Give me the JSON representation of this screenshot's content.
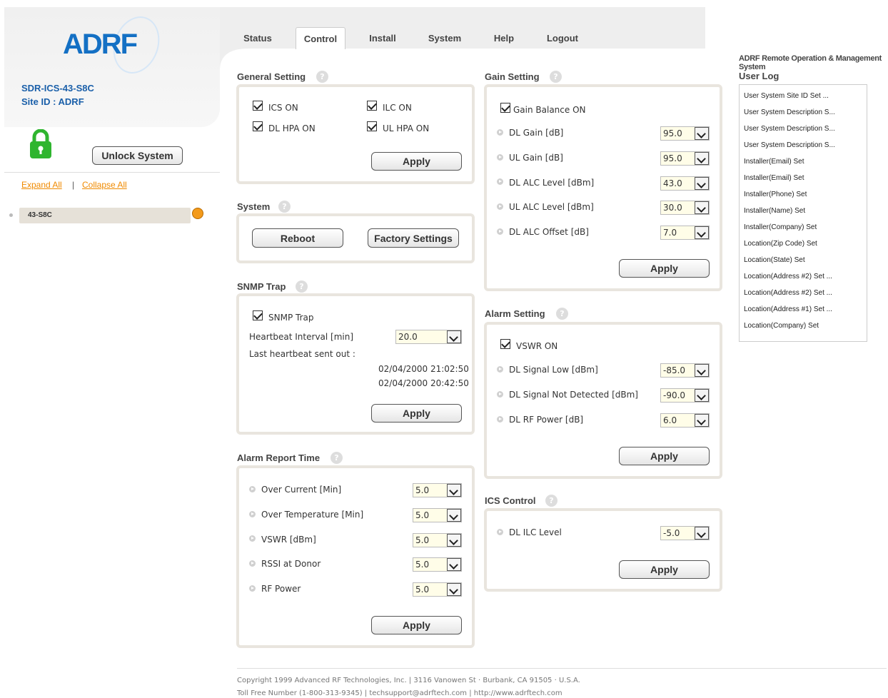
{
  "brand": {
    "logo_text": "ADRF",
    "device_name": "SDR-ICS-43-S8C",
    "site_id": "Site ID : ADRF"
  },
  "sidebar": {
    "unlock_label": "Unlock System",
    "expand_all": "Expand All",
    "separator": "|",
    "collapse_all": "Collapse All",
    "tree_item": "43-S8C",
    "status_color": "#f39a1b"
  },
  "nav": {
    "tabs": [
      "Status",
      "Control",
      "Install",
      "System",
      "Help",
      "Logout"
    ],
    "active": "Control"
  },
  "general_setting": {
    "title": "General Setting",
    "ics_on": "ICS ON",
    "ilc_on": "ILC ON",
    "dl_hpa_on": "DL HPA ON",
    "ul_hpa_on": "UL HPA ON",
    "apply": "Apply"
  },
  "system": {
    "title": "System",
    "reboot": "Reboot",
    "factory": "Factory Settings"
  },
  "snmp": {
    "title": "SNMP Trap",
    "check_label": "SNMP Trap",
    "heartbeat_label": "Heartbeat Interval [min]",
    "heartbeat_value": "20.0",
    "last_label": "Last heartbeat sent out :",
    "last_1": "02/04/2000 21:02:50",
    "last_2": "02/04/2000 20:42:50",
    "apply": "Apply"
  },
  "alarm_report": {
    "title": "Alarm Report Time",
    "rows": [
      {
        "label": "Over Current [Min]",
        "value": "5.0"
      },
      {
        "label": "Over Temperature [Min]",
        "value": "5.0"
      },
      {
        "label": "VSWR [dBm]",
        "value": "5.0"
      },
      {
        "label": "RSSI at Donor",
        "value": "5.0"
      },
      {
        "label": "RF Power",
        "value": "5.0"
      }
    ],
    "apply": "Apply"
  },
  "gain_setting": {
    "title": "Gain Setting",
    "balance": "Gain Balance ON",
    "rows": [
      {
        "label": "DL Gain [dB]",
        "value": "95.0"
      },
      {
        "label": "UL Gain [dB]",
        "value": "95.0"
      },
      {
        "label": "DL ALC Level [dBm]",
        "value": "43.0"
      },
      {
        "label": "UL ALC Level [dBm]",
        "value": "30.0"
      },
      {
        "label": "DL ALC Offset [dB]",
        "value": "7.0"
      }
    ],
    "apply": "Apply"
  },
  "alarm_setting": {
    "title": "Alarm Setting",
    "vswr": "VSWR ON",
    "rows": [
      {
        "label": "DL Signal Low [dBm]",
        "value": "-85.0"
      },
      {
        "label": "DL Signal Not Detected [dBm]",
        "value": "-90.0"
      },
      {
        "label": "DL RF Power [dB]",
        "value": "6.0"
      }
    ],
    "apply": "Apply"
  },
  "ics_control": {
    "title": "ICS Control",
    "rows": [
      {
        "label": "DL ILC Level",
        "value": "-5.0"
      }
    ],
    "apply": "Apply"
  },
  "user_log": {
    "system_title": "ADRF Remote Operation & Management System",
    "title": "User Log",
    "items": [
      "User System Site ID Set ...",
      "User System Description S...",
      "User System Description S...",
      "User System Description S...",
      "Installer(Email) Set",
      "Installer(Email) Set",
      "Installer(Phone) Set",
      "Installer(Name) Set",
      "Installer(Company) Set",
      "Location(Zip Code) Set",
      "Location(State) Set",
      "Location(Address #2) Set ...",
      "Location(Address #2) Set ...",
      "Location(Address #1) Set ...",
      "Location(Company) Set"
    ]
  },
  "footer": {
    "line1": "Copyright 1999 Advanced RF Technologies, Inc. | 3116 Vanowen St · Burbank, CA 91505 · U.S.A.",
    "line2": "Toll Free Number (1-800-313-9345) | techsupport@adrftech.com | http://www.adrftech.com"
  },
  "icons": {
    "help": "?"
  }
}
